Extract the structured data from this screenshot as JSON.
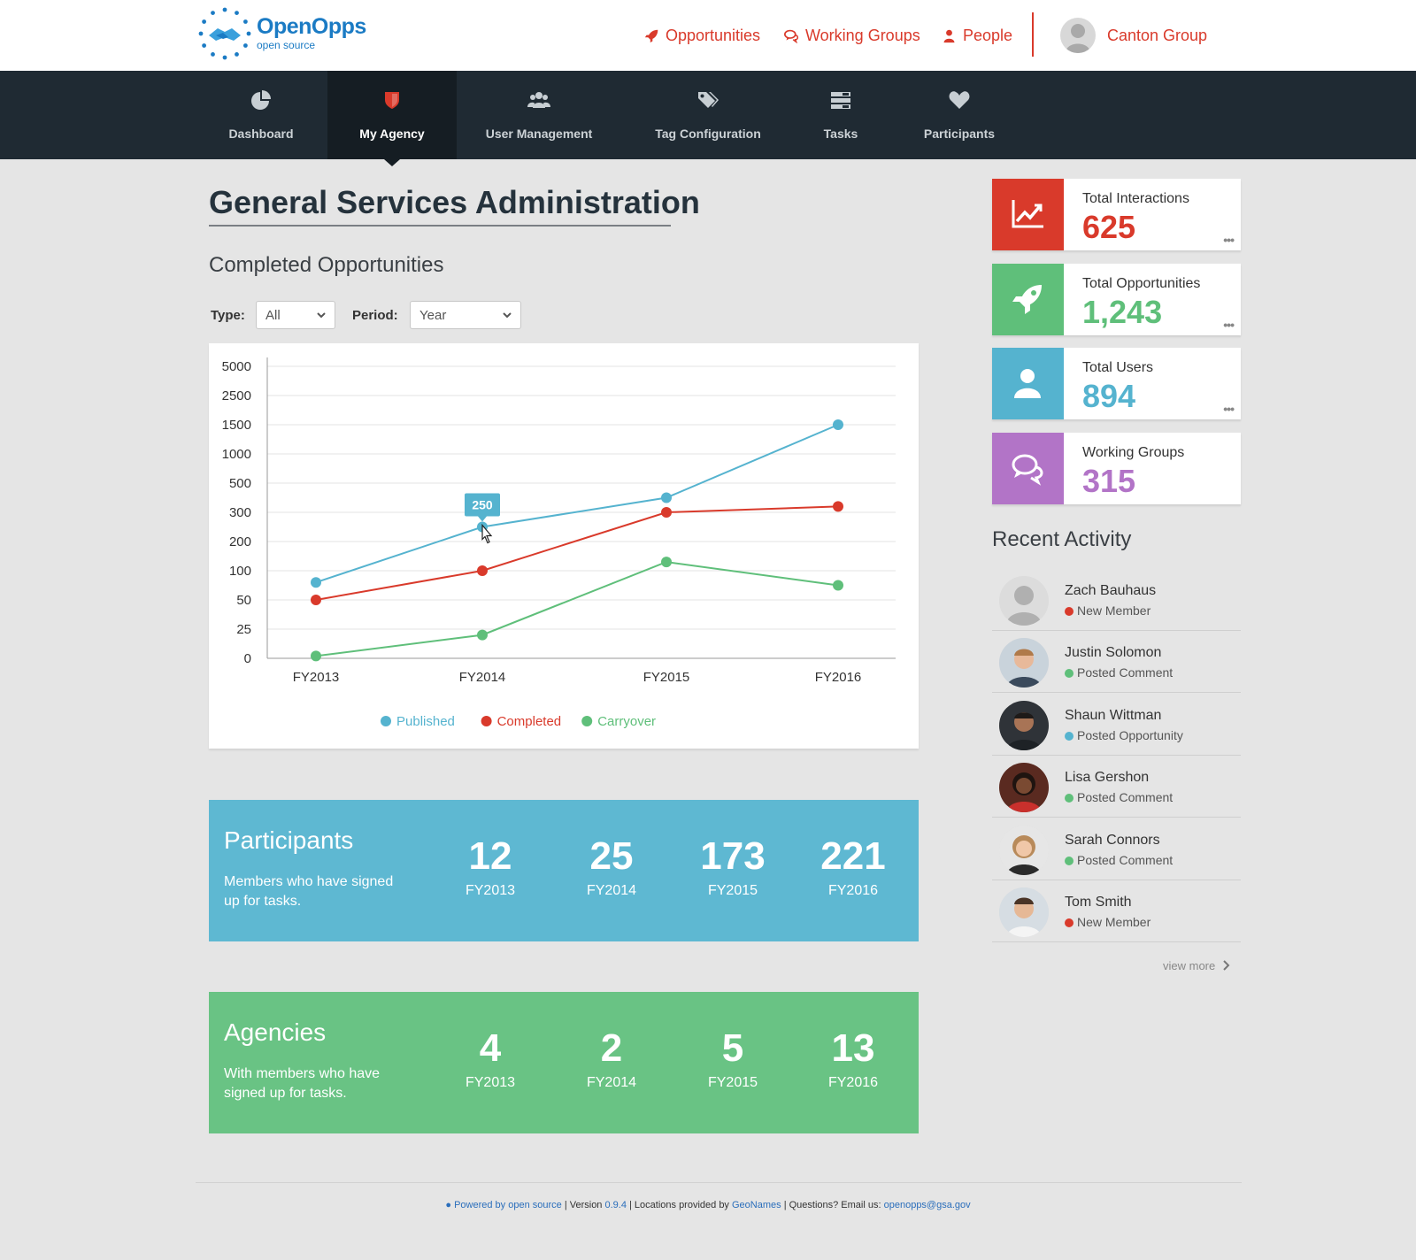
{
  "brand": {
    "name": "OpenOpps",
    "tagline": "open source"
  },
  "topnav": {
    "opportunities": "Opportunities",
    "working_groups": "Working Groups",
    "people": "People",
    "user_name": "Canton Group"
  },
  "tabs": [
    {
      "label": "Dashboard",
      "icon": "pie-chart-icon"
    },
    {
      "label": "My Agency",
      "icon": "shield-icon",
      "active": true
    },
    {
      "label": "User Management",
      "icon": "users-icon"
    },
    {
      "label": "Tag Configuration",
      "icon": "tags-icon"
    },
    {
      "label": "Tasks",
      "icon": "tasks-icon"
    },
    {
      "label": "Participants",
      "icon": "heart-icon"
    }
  ],
  "page": {
    "title": "General Services Administration",
    "section_title": "Completed Opportunities",
    "filters": {
      "type_label": "Type:",
      "type_value": "All",
      "period_label": "Period:",
      "period_value": "Year"
    }
  },
  "colors": {
    "published": "#55b3cf",
    "completed": "#d93a2b",
    "carryover": "#5fbf7a",
    "accent_red": "#d93a2b",
    "nav_dark": "#1f2a33"
  },
  "chart_data": {
    "type": "line",
    "categories": [
      "FY2013",
      "FY2014",
      "FY2015",
      "FY2016"
    ],
    "y_ticks": [
      "0",
      "25",
      "50",
      "100",
      "200",
      "300",
      "500",
      "1000",
      "1500",
      "2500",
      "5000"
    ],
    "series": [
      {
        "name": "Published",
        "values": [
          80,
          250,
          400,
          1500
        ]
      },
      {
        "name": "Completed",
        "values": [
          50,
          100,
          300,
          340
        ]
      },
      {
        "name": "Carryover",
        "values": [
          2,
          20,
          130,
          75
        ]
      }
    ],
    "tooltip": {
      "series": "Published",
      "category": "FY2014",
      "label": "250"
    },
    "grid": true,
    "legend": "bottom-center"
  },
  "participants": {
    "title": "Participants",
    "desc": "Members who have signed up for tasks.",
    "stats": [
      {
        "value": "12",
        "year": "FY2013"
      },
      {
        "value": "25",
        "year": "FY2014"
      },
      {
        "value": "173",
        "year": "FY2015"
      },
      {
        "value": "221",
        "year": "FY2016"
      }
    ]
  },
  "agencies": {
    "title": "Agencies",
    "desc": "With members who have signed up for tasks.",
    "stats": [
      {
        "value": "4",
        "year": "FY2013"
      },
      {
        "value": "2",
        "year": "FY2014"
      },
      {
        "value": "5",
        "year": "FY2015"
      },
      {
        "value": "13",
        "year": "FY2016"
      }
    ]
  },
  "kpis": [
    {
      "label": "Total Interactions",
      "value": "625",
      "color": "#d93a2b",
      "icon": "line-chart-icon",
      "more": "•••"
    },
    {
      "label": "Total Opportunities",
      "value": "1,243",
      "color": "#5fbf7a",
      "icon": "rocket-icon",
      "more": "•••"
    },
    {
      "label": "Total Users",
      "value": "894",
      "color": "#55b3cf",
      "icon": "user-icon",
      "more": "•••"
    },
    {
      "label": "Working Groups",
      "value": "315",
      "color": "#b274c7",
      "icon": "chat-bubbles-icon"
    }
  ],
  "recent_activity": {
    "title": "Recent Activity",
    "items": [
      {
        "name": "Zach  Bauhaus",
        "action": "New Member",
        "dot": "#d93a2b"
      },
      {
        "name": "Justin Solomon",
        "action": "Posted Comment",
        "dot": "#5fbf7a"
      },
      {
        "name": "Shaun Wittman",
        "action": "Posted Opportunity",
        "dot": "#55b3cf"
      },
      {
        "name": "Lisa Gershon",
        "action": "Posted Comment",
        "dot": "#5fbf7a"
      },
      {
        "name": "Sarah Connors",
        "action": "Posted Comment",
        "dot": "#5fbf7a"
      },
      {
        "name": "Tom Smith",
        "action": "New Member",
        "dot": "#d93a2b"
      }
    ],
    "view_more": "view more"
  },
  "footer": {
    "powered": "Powered by open source",
    "version_prefix": " | Version ",
    "version": "0.9.4",
    "locations": " | Locations provided by ",
    "geonames": "GeoNames",
    "questions": " | Questions? Email us: ",
    "email": "openopps@gsa.gov"
  }
}
